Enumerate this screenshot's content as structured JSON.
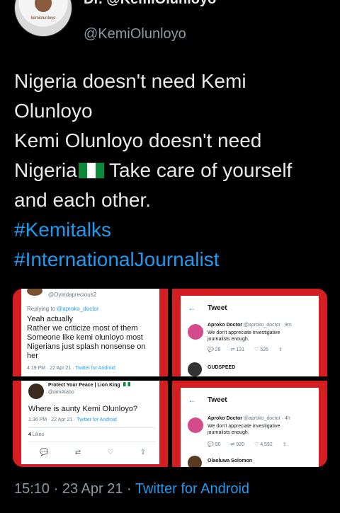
{
  "header": {
    "display_name": "Dr. @KemiOlunloyo",
    "handle": "@KemiOlunloyo",
    "avatar_caption": "kemiolunloyo"
  },
  "tweet": {
    "lines": [
      "Nigeria doesn't need Kemi Olunloyo",
      "Kemi Olunloyo doesn't need Nigeria",
      "Take care of yourself and each other."
    ],
    "hashtags": [
      "#Kemitalks",
      "#InternationalJournalist"
    ]
  },
  "media": {
    "img1": {
      "username": "@Oyindaprecious2",
      "replying_to_label": "Replying to",
      "replying_to_handle": "@aproko_doctor",
      "text_lines": [
        "Yeah actually",
        "Rather we criticize most of them",
        "Someone like kemi olunloyo most",
        "Nigerians just splash nonsense on",
        "her"
      ],
      "meta": "4:19 PM · 22 Apr 21 ·",
      "source": "Twitter for Android"
    },
    "img2": {
      "title": "Tweet",
      "author": "Aproko Doctor",
      "author_handle": "@aproko_doctor · 9m",
      "text": "We don't appreciate investigative journalists enough.",
      "replies": "28",
      "retweets": "131",
      "likes": "526",
      "next_author": "GUDSPEED"
    },
    "img3": {
      "display_name": "Protect Your Peace | Lion King",
      "handle": "@iamAtabo",
      "text": "Where is aunty Kemi Olunloyo?",
      "meta": "1:36 PM · 22 Apr 21 ·",
      "source": "Twitter for Android",
      "likes_count": "4",
      "likes_label": "Likes"
    },
    "img4": {
      "title": "Tweet",
      "author": "Aproko Doctor",
      "author_handle": "@aproko_doctor · 4h",
      "text": "We don't appreciate investigative journalists enough.",
      "replies": "90",
      "retweets": "920",
      "likes": "4,592",
      "next_author": "Olaoluwa Solomon"
    }
  },
  "footer": {
    "time": "15:10 · 23 Apr 21 ·",
    "source": "Twitter for Android"
  },
  "colors": {
    "background": "#000000",
    "link": "#1d9bf0",
    "secondary_text": "#8b98a5",
    "media_border_red": "#d31e22"
  }
}
